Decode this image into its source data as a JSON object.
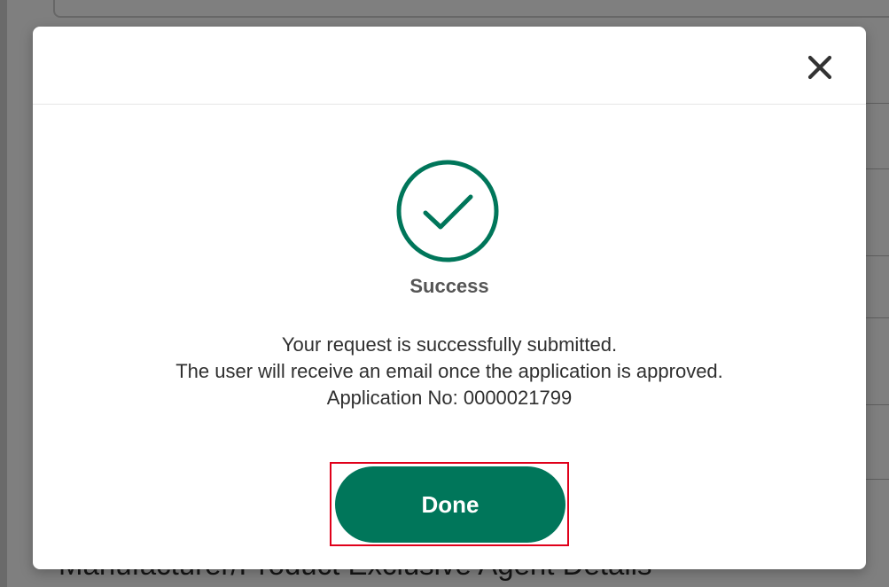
{
  "background_page": {
    "heading": "Manufacturer/Product Exclusive Agent Details"
  },
  "modal": {
    "close_icon": "close-icon",
    "status_icon": "check-circle-icon",
    "title": "Success",
    "message_lines": [
      "Your request is successfully submitted.",
      "The user will receive an email once the application is approved.",
      "Application No: 0000021799"
    ],
    "done_label": "Done"
  },
  "colors": {
    "accent": "#00765a",
    "highlight_border": "#e0001a",
    "backdrop": "rgba(0,0,0,0.5)"
  }
}
